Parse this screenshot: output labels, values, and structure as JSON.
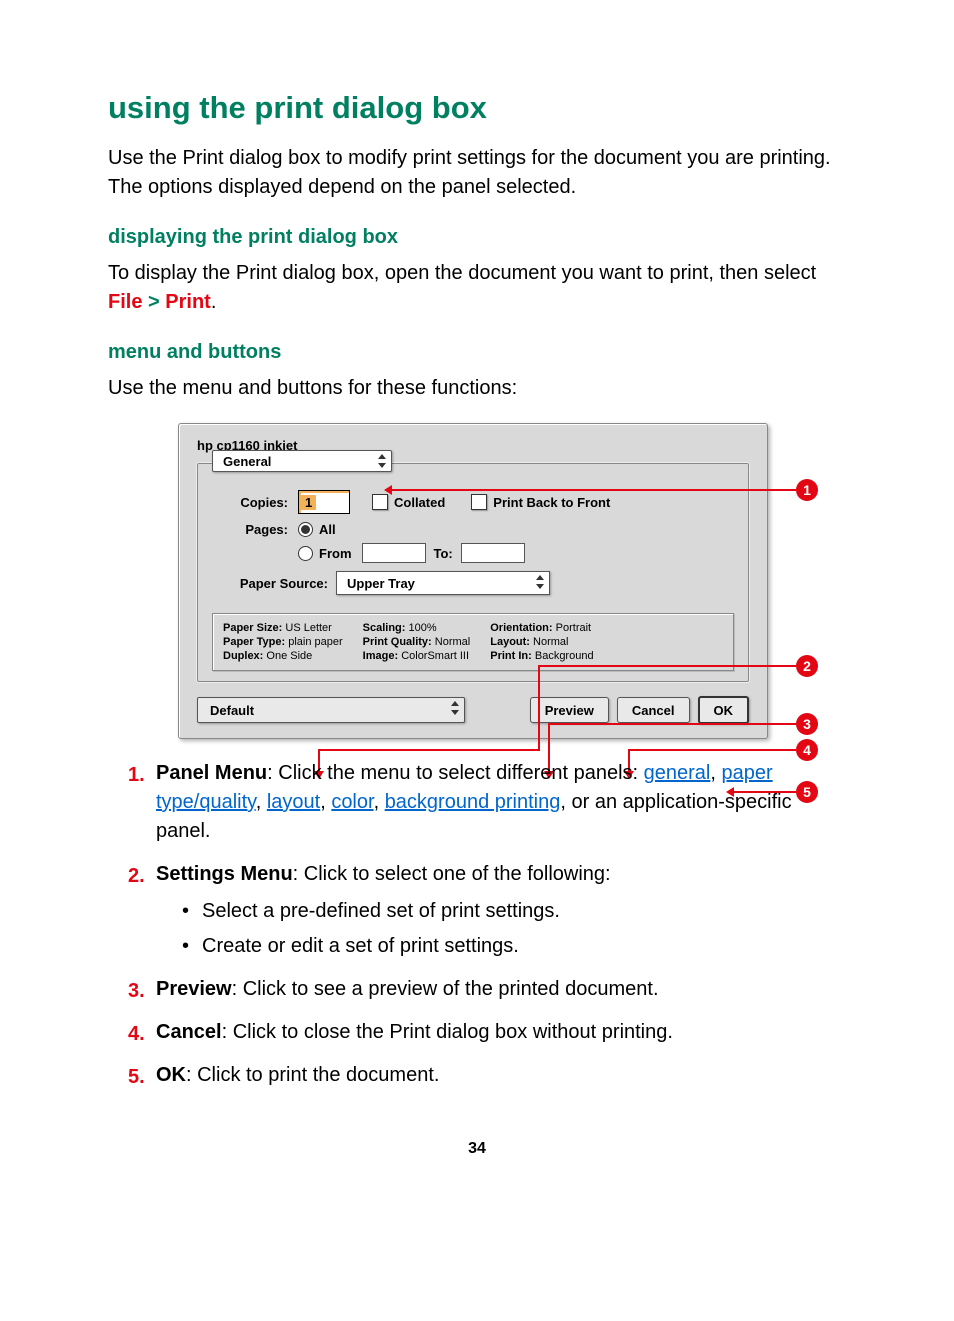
{
  "heading": "using the print dialog box",
  "intro": "Use the Print dialog box to modify print settings for the document you are printing. The options displayed depend on the panel selected.",
  "sub1": "displaying the print dialog box",
  "sub1_text_pre": "To display the Print dialog box, open the document you want to print, then select ",
  "file_label": "File",
  "gt": ">",
  "print_label": "Print",
  "period": ".",
  "sub2": "menu and buttons",
  "sub2_text": "Use the menu and buttons for these functions:",
  "dialog": {
    "title": "hp cp1160 inkjet",
    "panel_menu": "General",
    "copies_label": "Copies:",
    "copies_value": "1",
    "collated": "Collated",
    "print_back": "Print Back to Front",
    "pages_label": "Pages:",
    "all": "All",
    "from": "From",
    "to": "To:",
    "paper_source_label": "Paper Source:",
    "paper_source_value": "Upper Tray",
    "summary": {
      "paper_size_l": "Paper Size:",
      "paper_size_v": "US Letter",
      "paper_type_l": "Paper Type:",
      "paper_type_v": "plain paper",
      "duplex_l": "Duplex:",
      "duplex_v": "One Side",
      "scaling_l": "Scaling:",
      "scaling_v": "100%",
      "pq_l": "Print Quality:",
      "pq_v": "Normal",
      "image_l": "Image:",
      "image_v": "ColorSmart III",
      "orient_l": "Orientation:",
      "orient_v": "Portrait",
      "layout_l": "Layout:",
      "layout_v": "Normal",
      "printin_l": "Print In:",
      "printin_v": "Background"
    },
    "default_btn": "Default",
    "preview_btn": "Preview",
    "cancel_btn": "Cancel",
    "ok_btn": "OK"
  },
  "callouts": {
    "c1": "1",
    "c2": "2",
    "c3": "3",
    "c4": "4",
    "c5": "5"
  },
  "list": {
    "i1_title": "Panel Menu",
    "i1_pre": ": Click the menu to select different panels: ",
    "i1_links": {
      "general": "general",
      "ptq": "paper type/quality",
      "layout": "layout",
      "color": "color",
      "bg": "background printing"
    },
    "i1_post": ", or an application-specific panel.",
    "sep": ", ",
    "i2_title": "Settings Menu",
    "i2_text": ": Click to select one of the following:",
    "i2_b1": "Select a pre-defined set of print settings.",
    "i2_b2": "Create or edit a set of print settings.",
    "i3_title": "Preview",
    "i3_text": ": Click to see a preview of the printed document.",
    "i4_title": "Cancel",
    "i4_text": ": Click to close the Print dialog box without printing.",
    "i5_title": "OK",
    "i5_text": ": Click to print the document."
  },
  "page_number": "34"
}
